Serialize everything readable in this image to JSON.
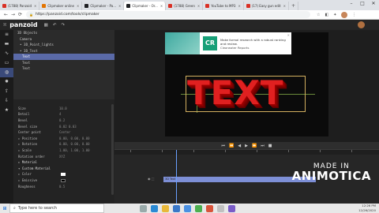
{
  "browser": {
    "tabs": [
      {
        "label": "(1788) Panzoid",
        "color": "#d93025",
        "active": false
      },
      {
        "label": "Clipmaker online",
        "color": "#e37400",
        "active": false
      },
      {
        "label": "Clipmaker - Pa...",
        "color": "#202124",
        "active": false
      },
      {
        "label": "Clipmaker - Or...",
        "color": "#202124",
        "active": true
      },
      {
        "label": "(1788) Green",
        "color": "#d93025",
        "active": false
      },
      {
        "label": "YouTube to MP3",
        "color": "#d93025",
        "active": false
      },
      {
        "label": "(17) Easy gun edit",
        "color": "#d93025",
        "active": false
      },
      {
        "label": "",
        "color": "#5f6368",
        "active": false
      }
    ],
    "url": "https://panzoid.com/tools/clipmaker",
    "win_buttons": [
      "–",
      "□",
      "✕"
    ]
  },
  "app": {
    "logo_text": "panzoid",
    "toolbar_icons": [
      "undo-icon",
      "redo-icon"
    ]
  },
  "iconbar": [
    "menu-icon",
    "folder-icon",
    "wave-icon",
    "shape-icon",
    "globe-icon",
    "gear-icon",
    "upload-icon",
    "download-icon",
    "star-icon"
  ],
  "tree": {
    "items": [
      {
        "label": "3D Objects",
        "indent": 0,
        "selected": false
      },
      {
        "label": "Camera",
        "indent": 1,
        "selected": false
      },
      {
        "label": "• 3D_Point_lights",
        "indent": 1,
        "selected": false
      },
      {
        "label": "• 3D_Text",
        "indent": 1,
        "selected": false
      },
      {
        "label": "Text",
        "indent": 1,
        "selected": true
      },
      {
        "label": "Text",
        "indent": 1,
        "selected": false
      },
      {
        "label": "Text",
        "indent": 1,
        "selected": false
      }
    ]
  },
  "props": {
    "rows": [
      {
        "label": "",
        "value": ""
      },
      {
        "label": "Size",
        "value": "10.0"
      },
      {
        "label": "Detail",
        "value": "4"
      },
      {
        "label": "Bevel",
        "value": "0.2"
      },
      {
        "label": "Bevel size",
        "value": "0.02  0.03"
      },
      {
        "label": "Center point",
        "value": "Center"
      },
      {
        "label": "▸ Position",
        "value": "0.00, 0.00, 0.00"
      },
      {
        "label": "▸ Rotation",
        "value": "0.00, 0.00, 0.00"
      },
      {
        "label": "▸ Scale",
        "value": "1.00, 1.00, 1.00"
      },
      {
        "label": "Rotation order",
        "value": "XYZ"
      },
      {
        "label": "▸ Material",
        "value": ""
      },
      {
        "label": "  ▾ Custom Material",
        "value": ""
      },
      {
        "label": "    ▸ Color",
        "value": "",
        "swatch": "#ffffff"
      },
      {
        "label": "    ▸ Emissive",
        "value": "",
        "swatch": "#000000"
      },
      {
        "label": "    Roughness",
        "value": "0.5"
      }
    ]
  },
  "viewport": {
    "ad": {
      "logo": "CR",
      "text": "Make formal research with a robust ranking and review.",
      "brand": "Clearwater Reports"
    },
    "title_text": "TEXT",
    "text_color": "#e02020"
  },
  "timeline": {
    "controls": [
      "⏮",
      "⏪",
      "◀",
      "▶",
      "⏩",
      "⏭",
      "■"
    ],
    "track_label": "3D Text"
  },
  "taskbar": {
    "search_placeholder": "Type here to search",
    "time": "12:26 PM",
    "date": "12/26/2020"
  },
  "watermark": {
    "line1": "MADE IN",
    "line2": "ANIMOTICA"
  }
}
